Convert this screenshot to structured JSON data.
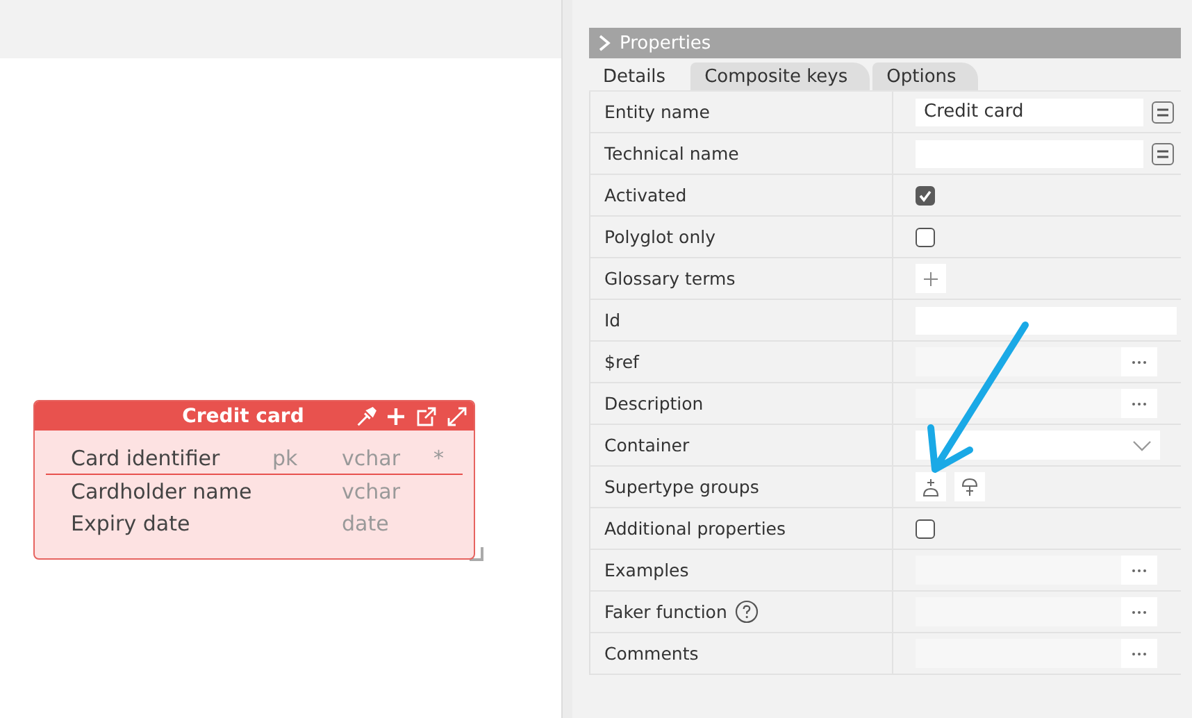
{
  "entity": {
    "title": "Credit card",
    "attributes": [
      {
        "name": "Card identifier",
        "key": "pk",
        "type": "vchar",
        "required": "*"
      },
      {
        "name": "Cardholder name",
        "type": "vchar"
      },
      {
        "name": "Expiry date",
        "type": "date"
      }
    ]
  },
  "properties": {
    "title": "Properties",
    "tabs": [
      {
        "label": "Details",
        "selected": true
      },
      {
        "label": "Composite keys",
        "selected": false
      },
      {
        "label": "Options",
        "selected": false
      }
    ],
    "rows": [
      {
        "label": "Entity name",
        "kind": "textmenu",
        "value": "Credit card"
      },
      {
        "label": "Technical name",
        "kind": "textmenu"
      },
      {
        "label": "Activated",
        "kind": "checkbox",
        "checked": true
      },
      {
        "label": "Polyglot only",
        "kind": "checkbox",
        "checked": false
      },
      {
        "label": "Glossary terms",
        "kind": "add"
      },
      {
        "label": "Id",
        "kind": "text"
      },
      {
        "label": "$ref",
        "kind": "ellipsis"
      },
      {
        "label": "Description",
        "kind": "ellipsis"
      },
      {
        "label": "Container",
        "kind": "select"
      },
      {
        "label": "Supertype groups",
        "kind": "icons"
      },
      {
        "label": "Additional properties",
        "kind": "checkbox",
        "checked": false
      },
      {
        "label": "Examples",
        "kind": "ellipsis"
      },
      {
        "label": "Faker function",
        "kind": "ellipsis",
        "help": true
      },
      {
        "label": "Comments",
        "kind": "ellipsis"
      }
    ]
  }
}
